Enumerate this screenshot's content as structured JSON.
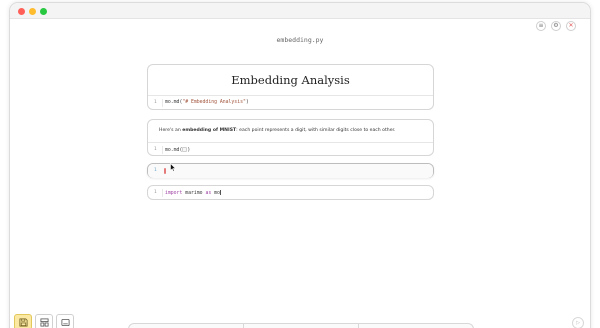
{
  "window": {
    "controls": [
      "close",
      "minimize",
      "maximize"
    ]
  },
  "toolbar": {
    "icons": [
      "menu-icon",
      "gear-icon",
      "close-icon"
    ],
    "icon_glyphs": [
      "≡",
      "⚙",
      "✕"
    ]
  },
  "file": {
    "name": "embedding.py"
  },
  "cells": [
    {
      "output_heading": "Embedding Analysis",
      "line_number": "1",
      "code_fn": "mo.md(",
      "code_str": "\"# Embedding Analysis\"",
      "code_close": ")"
    },
    {
      "output_pre": "Here's an ",
      "output_bold": "embedding of MNIST",
      "output_post": ": each point represents a digit, with similar digits close to each other.",
      "line_number": "1",
      "code_fn": "mo.md(",
      "code_close": ")"
    },
    {
      "line_number": "1",
      "code": ""
    },
    {
      "line_number": "1",
      "code_kw1": "import",
      "code_mid": " marimo ",
      "code_kw2": "as",
      "code_end": " mo"
    }
  ],
  "bottom_toolbar": {
    "buttons": [
      "save-icon",
      "layout-icon",
      "console-icon"
    ]
  },
  "run_button": {
    "glyph": "▷"
  },
  "colors": {
    "save_button_bg": "#fbe9a3",
    "close_red": "#ff5f57",
    "minimize_yellow": "#febc2e",
    "maximize_green": "#28c840",
    "string_literal": "#a0523a",
    "keyword": "#9c3ea0"
  }
}
